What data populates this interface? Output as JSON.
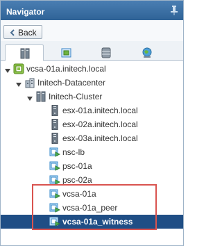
{
  "panel": {
    "title": "Navigator"
  },
  "toolbar": {
    "back_label": "Back"
  },
  "tabs": [
    {
      "name": "hosts-and-clusters",
      "active": true
    },
    {
      "name": "vms-and-templates",
      "active": false
    },
    {
      "name": "storage",
      "active": false
    },
    {
      "name": "networking",
      "active": false
    }
  ],
  "tree": [
    {
      "label": "vcsa-01a.initech.local",
      "icon": "vcenter-icon",
      "expanded": true
    },
    {
      "label": "Initech-Datacenter",
      "icon": "datacenter-icon",
      "expanded": true
    },
    {
      "label": "Initech-Cluster",
      "icon": "cluster-icon",
      "expanded": true
    },
    {
      "label": "esx-01a.initech.local",
      "icon": "host-icon"
    },
    {
      "label": "esx-02a.initech.local",
      "icon": "host-icon"
    },
    {
      "label": "esx-03a.initech.local",
      "icon": "host-icon"
    },
    {
      "label": "nsc-lb",
      "icon": "vm-icon"
    },
    {
      "label": "psc-01a",
      "icon": "vm-icon"
    },
    {
      "label": "psc-02a",
      "icon": "vm-icon"
    },
    {
      "label": "vcsa-01a",
      "icon": "vm-icon"
    },
    {
      "label": "vcsa-01a_peer",
      "icon": "vm-icon"
    },
    {
      "label": "vcsa-01a_witness",
      "icon": "vm-icon",
      "selected": true
    }
  ],
  "colors": {
    "titlebar": "#2f6397",
    "selection": "#1f4e85",
    "highlight_box": "#d9534f"
  }
}
